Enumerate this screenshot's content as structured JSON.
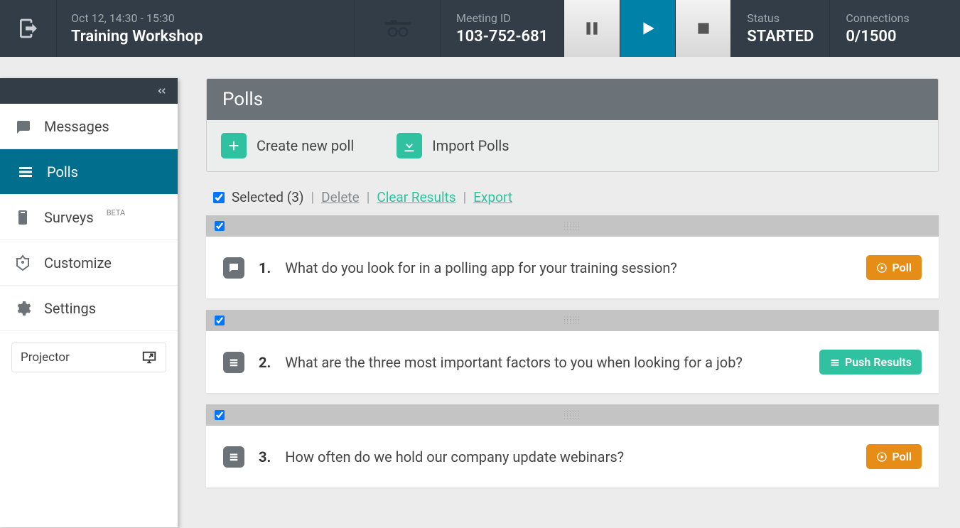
{
  "header": {
    "datetime": "Oct 12, 14:30 - 15:30",
    "title": "Training Workshop",
    "meeting_id_label": "Meeting ID",
    "meeting_id": "103-752-681",
    "status_label": "Status",
    "status": "STARTED",
    "connections_label": "Connections",
    "connections": "0/1500"
  },
  "sidebar": {
    "items": [
      {
        "label": "Messages"
      },
      {
        "label": "Polls"
      },
      {
        "label": "Surveys",
        "badge": "BETA"
      },
      {
        "label": "Customize"
      },
      {
        "label": "Settings"
      }
    ],
    "projector_label": "Projector"
  },
  "page": {
    "title": "Polls",
    "create_label": "Create new poll",
    "import_label": "Import Polls",
    "selected_label": "Selected (3)",
    "delete_label": "Delete",
    "clear_label": "Clear Results",
    "export_label": "Export"
  },
  "polls": [
    {
      "num": "1.",
      "question": "What do you look for in a polling app for your training session?",
      "button": "Poll",
      "style": "orange",
      "type": "open"
    },
    {
      "num": "2.",
      "question": "What are the three most important factors to you when looking for a job?",
      "button": "Push Results",
      "style": "teal",
      "type": "multi"
    },
    {
      "num": "3.",
      "question": "How often do we hold our company update webinars?",
      "button": "Poll",
      "style": "orange",
      "type": "multi"
    }
  ]
}
